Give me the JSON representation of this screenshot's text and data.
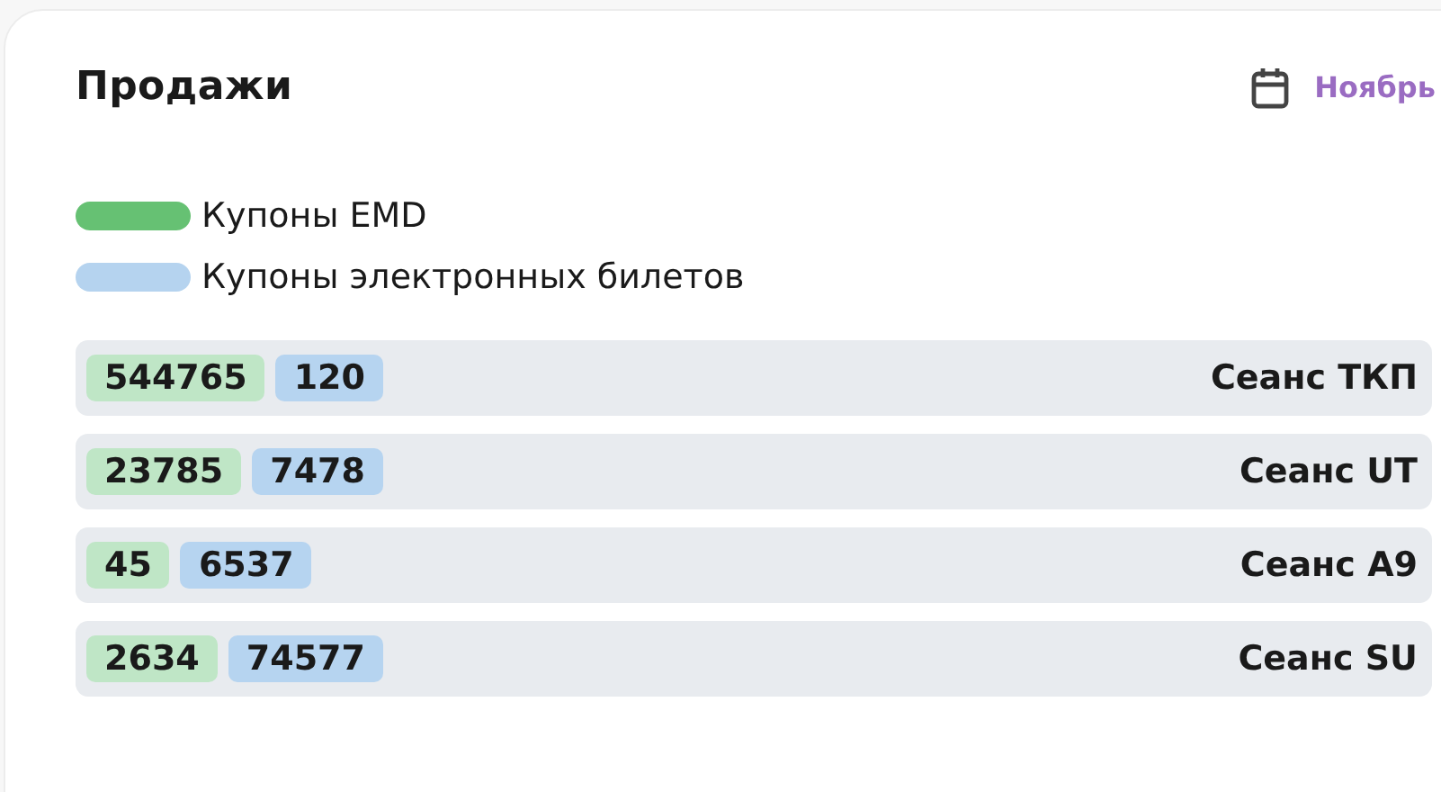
{
  "card": {
    "title": "Продажи",
    "period": {
      "label": "Ноябрь"
    }
  },
  "legend": [
    {
      "label": "Купоны EMD",
      "color": "#66c173"
    },
    {
      "label": "Купоны электронных билетов",
      "color": "#b5d3ef"
    }
  ],
  "rows": [
    {
      "name": "Сеанс ТКП",
      "counts": [
        {
          "kind": "emd",
          "value": "544765"
        },
        {
          "kind": "ticket",
          "value": "120"
        }
      ]
    },
    {
      "name": "Сеанс UT",
      "counts": [
        {
          "kind": "emd",
          "value": "23785"
        },
        {
          "kind": "ticket",
          "value": "7478"
        }
      ]
    },
    {
      "name": "Сеанс A9",
      "counts": [
        {
          "kind": "emd",
          "value": "45"
        },
        {
          "kind": "ticket",
          "value": "6537"
        }
      ]
    },
    {
      "name": "Сеанс SU",
      "counts": [
        {
          "kind": "emd",
          "value": "2634"
        },
        {
          "kind": "ticket",
          "value": "74577"
        }
      ]
    }
  ]
}
